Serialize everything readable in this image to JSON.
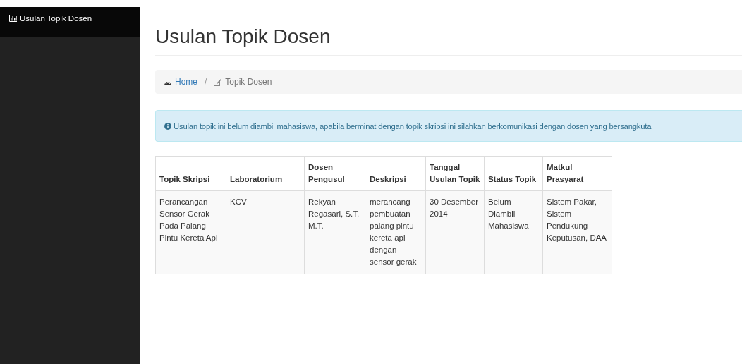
{
  "sidebar": {
    "brand": "Usulan Topik Dosen"
  },
  "page_title": "Usulan Topik Dosen",
  "breadcrumb_separator": "/",
  "breadcrumb": [
    {
      "label": "Home",
      "kind": "link"
    },
    {
      "label": "Topik Dosen",
      "kind": "current"
    }
  ],
  "alert": "Usulan topik ini belum diambil mahasiswa, apabila berminat dengan topik skripsi ini silahkan berkomunikasi dengan dosen yang bersangkuta",
  "table": {
    "columns": [
      "Topik Skripsi",
      "Laboratorium",
      "Dosen Pengusul",
      "Deskripsi",
      "Tanggal Usulan Topik",
      "Status Topik",
      "Matkul Prasyarat"
    ],
    "rows": [
      [
        "Perancangan Sensor Gerak Pada Palang Pintu Kereta Api",
        "KCV",
        "Rekyan Regasari, S.T, M.T.",
        "merancang pembuatan palang pintu kereta api dengan sensor gerak",
        "30 Desember 2014",
        "Belum Diambil Mahasiswa",
        "Sistem Pakar, Sistem Pendukung Keputusan, DAA"
      ]
    ]
  }
}
